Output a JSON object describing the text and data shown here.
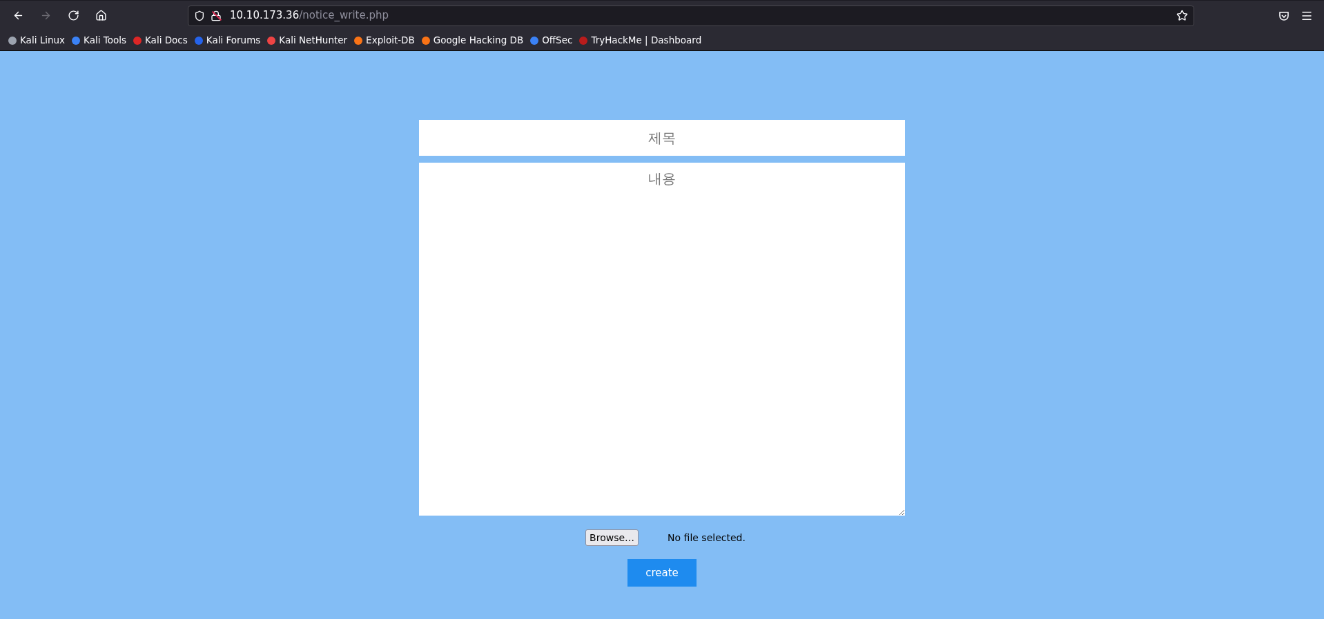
{
  "browser": {
    "nav_buttons": [
      {
        "kind": "back",
        "disabled": false
      },
      {
        "kind": "forward",
        "disabled": true
      },
      {
        "kind": "reload",
        "disabled": false
      },
      {
        "kind": "home",
        "disabled": false
      }
    ],
    "url": {
      "host": "10.10.173.36",
      "path": "/notice_write.php"
    },
    "bookmarks": [
      {
        "label": "Kali Linux",
        "color": "#9ca3af"
      },
      {
        "label": "Kali Tools",
        "color": "#3b82f6"
      },
      {
        "label": "Kali Docs",
        "color": "#dc2626"
      },
      {
        "label": "Kali Forums",
        "color": "#2563eb"
      },
      {
        "label": "Kali NetHunter",
        "color": "#ef4444"
      },
      {
        "label": "Exploit-DB",
        "color": "#f97316"
      },
      {
        "label": "Google Hacking DB",
        "color": "#f97316"
      },
      {
        "label": "OffSec",
        "color": "#3b82f6"
      },
      {
        "label": "TryHackMe | Dashboard",
        "color": "#b91c1c"
      }
    ]
  },
  "form": {
    "title_field": {
      "placeholder": "제목"
    },
    "content_field": {
      "placeholder": "내용"
    },
    "file_input": {
      "button": "Browse…",
      "status": "No file selected."
    },
    "submit_button": "create"
  }
}
